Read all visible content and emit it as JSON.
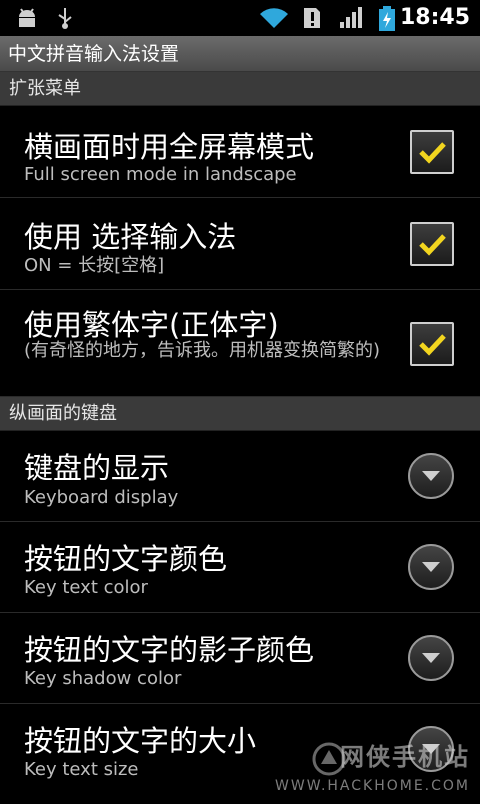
{
  "status_bar": {
    "time": "18:45",
    "icons": [
      "android-debug-icon",
      "usb-icon",
      "wifi-icon",
      "alert-icon",
      "signal-icon",
      "battery-charging-icon"
    ]
  },
  "title_bar": {
    "title": "中文拼音输入法设置"
  },
  "sections": [
    {
      "header": "扩张菜单"
    },
    {
      "header": "纵画面的键盘"
    }
  ],
  "checkbox_items": [
    {
      "title": "横画面时用全屏幕模式",
      "summary": "Full screen mode in landscape",
      "checked": true
    },
    {
      "title": "使用 选择输入法",
      "summary": "ON = 长按[空格]",
      "checked": true
    },
    {
      "title": "使用繁体字(正体字)",
      "summary": "(有奇怪的地方，告诉我。用机器变换简繁的)",
      "checked": true
    }
  ],
  "list_items": [
    {
      "title": "键盘的显示",
      "summary": "Keyboard display"
    },
    {
      "title": "按钮的文字颜色",
      "summary": "Key text color"
    },
    {
      "title": "按钮的文字的影子颜色",
      "summary": "Key shadow color"
    },
    {
      "title": "按钮的文字的大小",
      "summary": "Key text size"
    }
  ],
  "watermark": {
    "text": "网侠手机站",
    "url": "WWW.HACKHOME.COM"
  },
  "colors": {
    "check": "#f2d51f",
    "section_bg": "#3a3a3a",
    "titlebar_bg": "#5a5a5a"
  }
}
